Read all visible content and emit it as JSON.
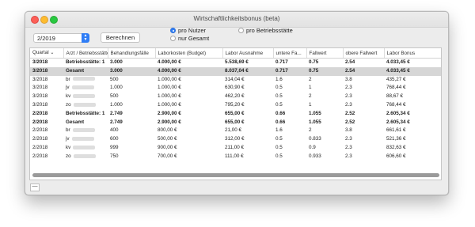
{
  "window": {
    "title": "Wirtschaftlichkeitsbonus (beta)"
  },
  "toolbar": {
    "period_value": "2/2019",
    "button_label": "Berechnen",
    "radio_per_user": "pro Nutzer",
    "radio_total_only": "nur Gesamt",
    "radio_per_site": "pro Betriebsstätte",
    "radio_per_user_selected": true
  },
  "table": {
    "columns": [
      "Quartal",
      "Arzt / Betriebsstätte",
      "Behandlungsfälle",
      "Laborkosten (Budget)",
      "Labor Ausnahme",
      "untere Fa...",
      "Fallwert",
      "obere Fallwert",
      "Labor Bonus"
    ],
    "rows": [
      {
        "q": "3/2018",
        "name": "Betriebsstätte: 1",
        "faelle": "3.000",
        "kosten": "4.000,00 €",
        "ausnahme": "5.538,69 €",
        "untere": "0.717",
        "fallwert": "0.75",
        "obere": "2.54",
        "bonus": "4.033,45 €",
        "bold": true
      },
      {
        "q": "3/2018",
        "name": "Gesamt",
        "faelle": "3.000",
        "kosten": "4.000,00 €",
        "ausnahme": "8.037,04 €",
        "untere": "0.717",
        "fallwert": "0.75",
        "obere": "2.54",
        "bonus": "4.033,45 €",
        "bold": true,
        "selected": true
      },
      {
        "q": "3/2018",
        "name": "br",
        "faelle": "500",
        "kosten": "1.000,00 €",
        "ausnahme": "314,04 €",
        "untere": "1.6",
        "fallwert": "2",
        "obere": "3.8",
        "bonus": "435,27 €"
      },
      {
        "q": "3/2018",
        "name": "jv",
        "faelle": "1.000",
        "kosten": "1.000,00 €",
        "ausnahme": "630,90 €",
        "untere": "0.5",
        "fallwert": "1",
        "obere": "2.3",
        "bonus": "768,44 €"
      },
      {
        "q": "3/2018",
        "name": "kv",
        "faelle": "500",
        "kosten": "1.000,00 €",
        "ausnahme": "462,20 €",
        "untere": "0.5",
        "fallwert": "2",
        "obere": "2.3",
        "bonus": "88,67 €"
      },
      {
        "q": "3/2018",
        "name": "zo",
        "faelle": "1.000",
        "kosten": "1.000,00 €",
        "ausnahme": "795,20 €",
        "untere": "0.5",
        "fallwert": "1",
        "obere": "2.3",
        "bonus": "768,44 €"
      },
      {
        "q": "2/2018",
        "name": "Betriebsstätte: 1",
        "faelle": "2.749",
        "kosten": "2.900,00 €",
        "ausnahme": "655,00 €",
        "untere": "0.66",
        "fallwert": "1.055",
        "obere": "2.52",
        "bonus": "2.605,34 €",
        "bold": true
      },
      {
        "q": "2/2018",
        "name": "Gesamt",
        "faelle": "2.749",
        "kosten": "2.900,00 €",
        "ausnahme": "655,00 €",
        "untere": "0.66",
        "fallwert": "1.055",
        "obere": "2.52",
        "bonus": "2.605,34 €",
        "bold": true
      },
      {
        "q": "2/2018",
        "name": "br",
        "faelle": "400",
        "kosten": "800,00 €",
        "ausnahme": "21,00 €",
        "untere": "1.6",
        "fallwert": "2",
        "obere": "3.8",
        "bonus": "661,61 €"
      },
      {
        "q": "2/2018",
        "name": "jv",
        "faelle": "600",
        "kosten": "500,00 €",
        "ausnahme": "312,00 €",
        "untere": "0.5",
        "fallwert": "0.833",
        "obere": "2.3",
        "bonus": "521,36 €"
      },
      {
        "q": "2/2018",
        "name": "kv",
        "faelle": "999",
        "kosten": "900,00 €",
        "ausnahme": "211,00 €",
        "untere": "0.5",
        "fallwert": "0.9",
        "obere": "2.3",
        "bonus": "832,63 €"
      },
      {
        "q": "2/2018",
        "name": "zo",
        "faelle": "750",
        "kosten": "700,00 €",
        "ausnahme": "111,00 €",
        "untere": "0.5",
        "fallwert": "0.933",
        "obere": "2.3",
        "bonus": "606,60 €"
      }
    ]
  },
  "statusbar": {
    "remove_label": "—"
  }
}
